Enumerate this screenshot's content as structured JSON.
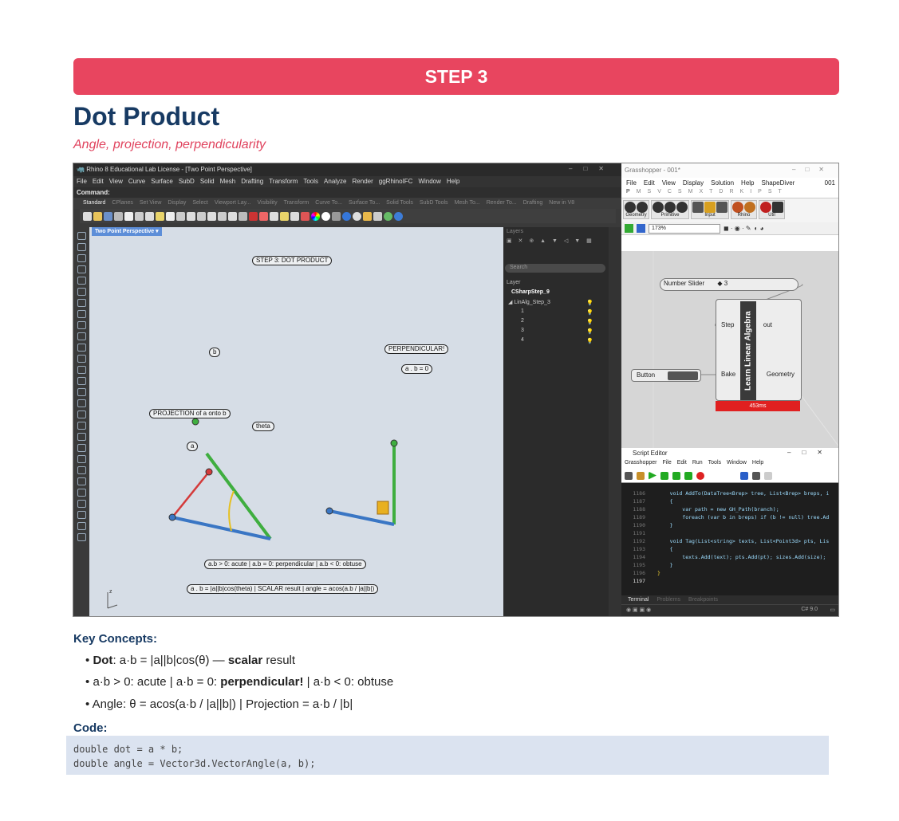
{
  "header": {
    "step_label": "STEP 3",
    "title": "Dot Product",
    "subtitle": "Angle, projection, perpendicularity"
  },
  "rhino": {
    "window_title": "Rhino 8 Educational Lab License - [Two Point Perspective]",
    "menu": [
      "File",
      "Edit",
      "View",
      "Curve",
      "Surface",
      "SubD",
      "Solid",
      "Mesh",
      "Drafting",
      "Transform",
      "Tools",
      "Analyze",
      "Render",
      "ggRhinoIFC",
      "Window",
      "Help"
    ],
    "command_label": "Command:",
    "toolbar_tabs": [
      "Standard",
      "CPlanes",
      "Set View",
      "Display",
      "Select",
      "Viewport Lay...",
      "Visibility",
      "Transform",
      "Curve To...",
      "Surface To...",
      "Solid Tools",
      "SubD Tools",
      "Mesh To...",
      "Render To...",
      "Drafting",
      "New in V8"
    ],
    "viewport_tab": "Two Point Perspective",
    "viewport_labels": {
      "step": "STEP 3: DOT PRODUCT",
      "b": "b",
      "a": "a",
      "theta": "theta",
      "projection": "PROJECTION of a onto b",
      "perpendicular": "PERPENDICULAR!",
      "ab_zero": "a . b = 0",
      "rule": "a.b > 0: acute  |  a.b = 0: perpendicular  |  a.b < 0: obtuse",
      "formula": "a . b = |a||b|cos(theta)  |  SCALAR result  |  angle = acos(a.b / |a||b|)",
      "axis_z": "z"
    },
    "layers": {
      "panel_title": "Layers",
      "search_placeholder": "Search",
      "column_header": "Layer",
      "rows": [
        "CSharpStep_9",
        "LinAlg_Step_3",
        "1",
        "2",
        "3",
        "4"
      ]
    }
  },
  "grasshopper": {
    "window_title": "Grasshopper - 001*",
    "menu": [
      "File",
      "Edit",
      "View",
      "Display",
      "Solution",
      "Help",
      "ShapeDiver"
    ],
    "doc_name": "001",
    "tabs": [
      "P",
      "M",
      "S",
      "V",
      "C",
      "S",
      "M",
      "X",
      "T",
      "D",
      "R",
      "K",
      "I",
      "P",
      "S",
      "T"
    ],
    "groups": [
      "Geometry",
      "Primitive",
      "Input",
      "Rhino",
      "Util"
    ],
    "zoom": "173%",
    "slider_label": "Number Slider",
    "slider_value": "3",
    "component_name": "Learn Linear Algebra",
    "inputs": [
      "Step",
      "Bake"
    ],
    "outputs": [
      "out",
      "Geometry"
    ],
    "button_label": "Button",
    "timing": "453ms"
  },
  "script_editor": {
    "window_title": "Script Editor",
    "menu": [
      "Grasshopper",
      "File",
      "Edit",
      "Run",
      "Tools",
      "Window",
      "Help"
    ],
    "line_numbers": [
      "1186",
      "1187",
      "1188",
      "1189",
      "1190",
      "1191",
      "1192",
      "1193",
      "1194",
      "1195",
      "1196",
      "1197"
    ],
    "code_lines": [
      "    void AddTo(DataTree<Brep> tree, List<Brep> breps, i",
      "    {",
      "        var path = new GH_Path(branch);",
      "        foreach (var b in breps) if (b != null) tree.Ad",
      "    }",
      "",
      "    void Tag(List<string> texts, List<Point3d> pts, Lis",
      "    {",
      "        texts.Add(text); pts.Add(pt); sizes.Add(size);",
      "    }",
      "}",
      ""
    ],
    "bottom_tabs": [
      "Terminal",
      "Problems",
      "Breakpoints"
    ],
    "language": "C# 9.0"
  },
  "concepts": {
    "heading": "Key Concepts:",
    "items": [
      {
        "bold": "Dot",
        "text": ": a·b = |a||b|cos(θ) — ",
        "bold2": "scalar",
        "text2": " result"
      },
      {
        "text": "a·b > 0: acute | a·b = 0: ",
        "bold": "perpendicular!",
        "text2": " | a·b < 0: obtuse"
      },
      {
        "text": "Angle: θ = acos(a·b / |a||b|) | Projection = a·b / |b|"
      }
    ],
    "bullet": "•"
  },
  "code": {
    "heading": "Code:",
    "lines": [
      "double dot = a * b;",
      "double angle = Vector3d.VectorAngle(a, b);"
    ]
  },
  "colors": {
    "banner": "#e8455f",
    "title": "#173a63",
    "subtitle": "#e0425d",
    "vector_green": "#3fae3f",
    "vector_blue": "#3a76c4",
    "vector_red": "#d43a3a",
    "arc_yellow": "#e6c020"
  }
}
